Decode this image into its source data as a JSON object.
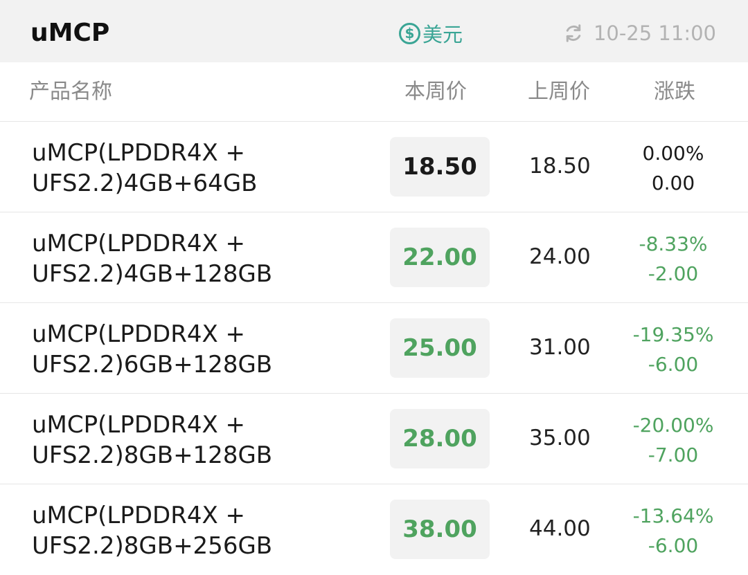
{
  "header": {
    "title": "uMCP",
    "currency_symbol": "$",
    "currency_label": "美元",
    "update_time": "10-25 11:00",
    "accent_color": "#3aa595"
  },
  "columns": {
    "name": "产品名称",
    "this_week": "本周价",
    "last_week": "上周价",
    "change": "涨跌"
  },
  "rows": [
    {
      "name_line1": "uMCP(LPDDR4X +",
      "name_line2": "UFS2.2)4GB+64GB",
      "this_week": "18.50",
      "last_week": "18.50",
      "change_pct": "0.00%",
      "change_abs": "0.00",
      "trend": "neutral"
    },
    {
      "name_line1": "uMCP(LPDDR4X +",
      "name_line2": "UFS2.2)4GB+128GB",
      "this_week": "22.00",
      "last_week": "24.00",
      "change_pct": "-8.33%",
      "change_abs": "-2.00",
      "trend": "down"
    },
    {
      "name_line1": "uMCP(LPDDR4X +",
      "name_line2": "UFS2.2)6GB+128GB",
      "this_week": "25.00",
      "last_week": "31.00",
      "change_pct": "-19.35%",
      "change_abs": "-6.00",
      "trend": "down"
    },
    {
      "name_line1": "uMCP(LPDDR4X +",
      "name_line2": "UFS2.2)8GB+128GB",
      "this_week": "28.00",
      "last_week": "35.00",
      "change_pct": "-20.00%",
      "change_abs": "-7.00",
      "trend": "down"
    },
    {
      "name_line1": "uMCP(LPDDR4X +",
      "name_line2": "UFS2.2)8GB+256GB",
      "this_week": "38.00",
      "last_week": "44.00",
      "change_pct": "-13.64%",
      "change_abs": "-6.00",
      "trend": "down"
    }
  ],
  "colors": {
    "down": "#4fa35f",
    "neutral": "#1a1a1a"
  }
}
